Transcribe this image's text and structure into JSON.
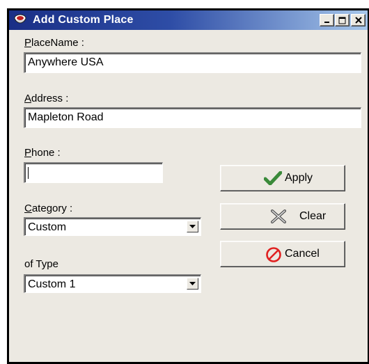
{
  "window": {
    "title": "Add Custom Place",
    "controls": {
      "minimize": "_",
      "maximize": "□",
      "close": "×"
    }
  },
  "form": {
    "place_name": {
      "label_first": "P",
      "label_rest": "laceName :",
      "value": "Anywhere USA"
    },
    "address": {
      "label_first": "A",
      "label_rest": "ddress :",
      "value": "Mapleton Road"
    },
    "phone": {
      "label_first": "P",
      "label_rest": "hone :",
      "value": ""
    },
    "category": {
      "label_first": "C",
      "label_rest": "ategory :",
      "selected": "Custom"
    },
    "type": {
      "label": "of Type",
      "selected": "Custom 1"
    }
  },
  "buttons": {
    "apply": {
      "label": "Apply",
      "icon": "checkmark-icon",
      "color": "#3a8a3a"
    },
    "clear": {
      "label": "Clear",
      "icon": "x-icon"
    },
    "cancel": {
      "label": "Cancel",
      "icon": "cancel-icon",
      "color": "#e02020"
    }
  },
  "colors": {
    "titlebar_start": "#1a2f86",
    "titlebar_end": "#a6c6ea",
    "dialog_bg": "#ece9e2"
  }
}
